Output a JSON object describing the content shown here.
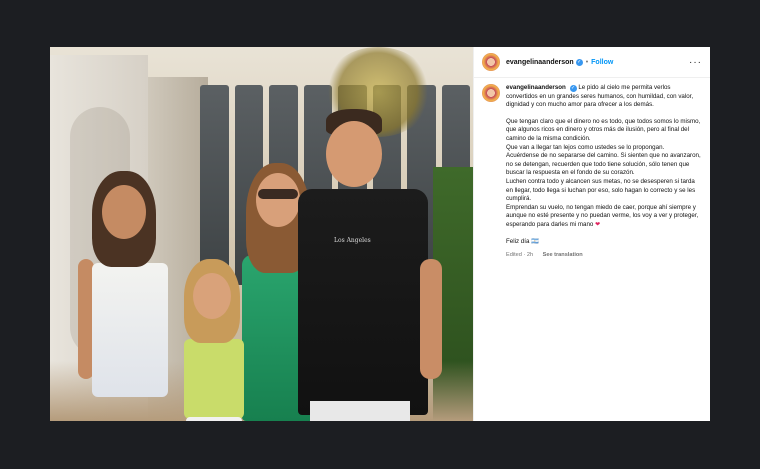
{
  "post": {
    "username": "evangelinaanderson",
    "follow_label": "Follow",
    "separator": "•",
    "more_label": "···",
    "caption_first_line": "Le pido al cielo me permita verlos convertidos en un grandes seres humanos, con humildad, con valor, dignidad y con mucho amor para ofrecer a los demás.",
    "caption_body": [
      "Que tengan claro que el dinero no es todo, que todos somos lo mismo, que algunos ricos en dinero y otros más de ilusión, pero al final del camino de la misma condición.",
      "Que van a llegar tan lejos como ustedes se lo propongan.",
      "Acuérdense de no separarse del camino. Si sienten que no avanzaron, no se detengan, recuerden que todo tiene solución, sólo tenen que buscar la respuesta en el fondo de su corazón.",
      "Luchen contra todo y alcancen sus metas, no se desesperen si tarda en llegar, todo llega si luchan por eso, solo hagan lo correcto y se les cumplirá.",
      "Emprendan su vuelo, no tengan miedo de caer, porque ahí siempre y aunque no esté presente y no puedan verme, los voy a ver y proteger, esperando para darles mi mano"
    ],
    "heart": "❤",
    "sign_off": "Feliz día 🇦🇷",
    "edited": "Edited · 2h",
    "see_translation": "See translation",
    "shirt_text": "Los Angeles"
  },
  "colors": {
    "backdrop": "#1c1e22",
    "follow_blue": "#0095f6",
    "verified_blue": "#3797f0"
  }
}
